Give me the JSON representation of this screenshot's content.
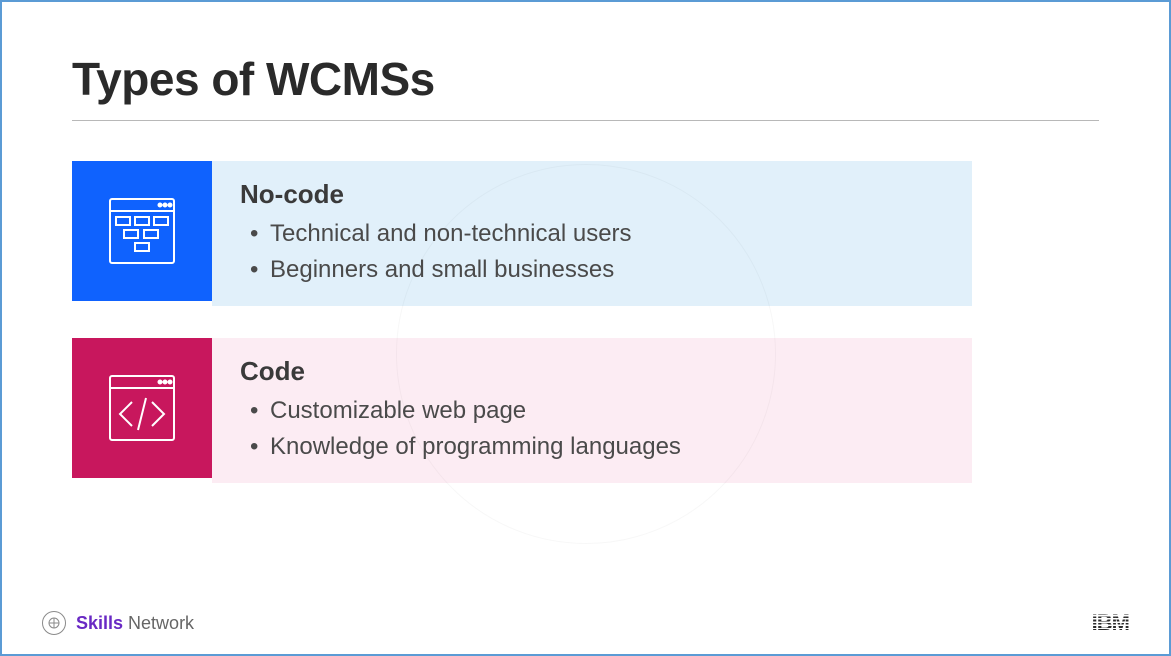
{
  "title": "Types of WCMSs",
  "cards": [
    {
      "heading": "No-code",
      "bullets": [
        "Technical and non-technical users",
        "Beginners and small businesses"
      ]
    },
    {
      "heading": "Code",
      "bullets": [
        "Customizable web page",
        "Knowledge of programming languages"
      ]
    }
  ],
  "footer": {
    "skills": "Skills",
    "network": "Network",
    "ibm": "IBM"
  }
}
